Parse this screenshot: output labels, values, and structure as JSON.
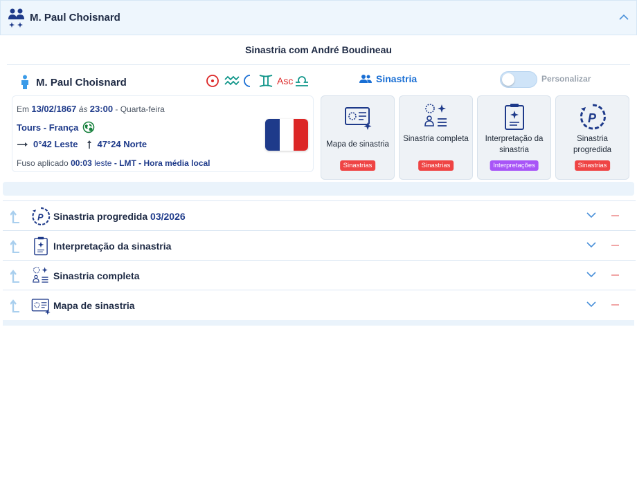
{
  "header": {
    "name": "M. Paul Choisnard"
  },
  "subtitle": "Sinastria com André Boudineau",
  "person": {
    "name": "M. Paul Choisnard"
  },
  "signs": {
    "asc_label": "Asc"
  },
  "sinastria": {
    "label": "Sinastria"
  },
  "toggle": {
    "label": "Personalizar",
    "on": false
  },
  "info": {
    "prefix": "Em",
    "date": "13/02/1867",
    "as": "às",
    "time": "23:00",
    "weekday": "- Quarta-feira",
    "place": "Tours - França",
    "longitude": "0°42 Leste",
    "latitude": "47°24 Norte",
    "fuso_label": "Fuso aplicado",
    "fuso_value": "00:03",
    "fuso_dir": "leste",
    "fuso_desc": "- LMT - Hora média local"
  },
  "flag_colors": [
    "#1e3a8a",
    "#ffffff",
    "#dc2626"
  ],
  "cards": [
    {
      "label": "Mapa de sinastria",
      "badge": "Sinastrias",
      "badge_color": "#ef4444",
      "icon": "synastry-chart-icon"
    },
    {
      "label": "Sinastria completa",
      "badge": "Sinastrias",
      "badge_color": "#ef4444",
      "icon": "full-synastry-icon"
    },
    {
      "label": "Interpretação da sinastria",
      "badge": "Interpretações",
      "badge_color": "#a855f7",
      "icon": "interpretation-icon"
    },
    {
      "label": "Sinastria progredida",
      "badge": "Sinastrias",
      "badge_color": "#ef4444",
      "icon": "progressed-icon"
    }
  ],
  "rows": [
    {
      "label": "Sinastria progredida",
      "date": "03/2026",
      "icon": "progressed-icon"
    },
    {
      "label": "Interpretação da sinastria",
      "date": "",
      "icon": "interpretation-icon"
    },
    {
      "label": "Sinastria completa",
      "date": "",
      "icon": "full-synastry-icon"
    },
    {
      "label": "Mapa de sinastria",
      "date": "",
      "icon": "synastry-chart-icon"
    }
  ],
  "colors": {
    "accent": "#1a6fd4",
    "navy": "#1e3a8a",
    "badge_red": "#ef4444",
    "badge_purple": "#a855f7"
  }
}
